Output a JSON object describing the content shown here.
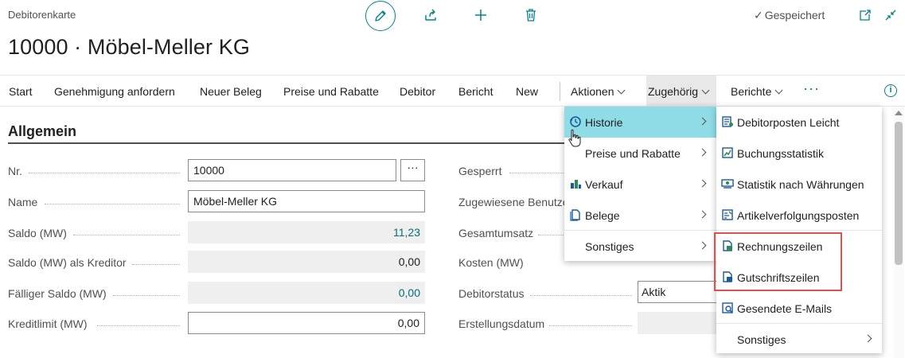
{
  "page": {
    "caption": "Debitorenkarte",
    "title": "10000 · Möbel-Meller KG",
    "saved_status": "Gespeichert"
  },
  "actionbar": {
    "items": [
      {
        "label": "Start"
      },
      {
        "label": "Genehmigung anfordern"
      },
      {
        "label": "Neuer Beleg"
      },
      {
        "label": "Preise und Rabatte"
      },
      {
        "label": "Debitor"
      },
      {
        "label": "Bericht"
      },
      {
        "label": "New"
      },
      {
        "label": "Aktionen"
      },
      {
        "label": "Zugehörig"
      },
      {
        "label": "Berichte"
      }
    ],
    "more": "···"
  },
  "section": {
    "title": "Allgemein"
  },
  "fields_left": [
    {
      "label": "Nr.",
      "value": "10000"
    },
    {
      "label": "Name",
      "value": "Möbel-Meller KG"
    },
    {
      "label": "Saldo (MW)",
      "value": "11,23"
    },
    {
      "label": "Saldo (MW) als Kreditor",
      "value": "0,00"
    },
    {
      "label": "Fälliger Saldo (MW)",
      "value": "0,00"
    },
    {
      "label": "Kreditlimit (MW)",
      "value": "0,00"
    }
  ],
  "lookup_button": "···",
  "fields_right": [
    {
      "label": "Gesperrt"
    },
    {
      "label": "Zugewiesene Benutzer"
    },
    {
      "label": "Gesamtumsatz"
    },
    {
      "label": "Kosten (MW)"
    },
    {
      "label": "Debitorstatus",
      "value": "Aktik"
    },
    {
      "label": "Erstellungsdatum"
    }
  ],
  "menu_zugehoerig": [
    {
      "label": "Historie",
      "icon": "history-icon",
      "active": true
    },
    {
      "label": "Preise und Rabatte",
      "icon": ""
    },
    {
      "label": "Verkauf",
      "icon": "sales-icon"
    },
    {
      "label": "Belege",
      "icon": "document-icon"
    },
    {
      "label": "Sonstiges",
      "icon": ""
    }
  ],
  "menu_historie": [
    {
      "label": "Debitorposten Leicht",
      "icon": "ledger-entries-icon"
    },
    {
      "label": "Buchungsstatistik",
      "icon": "posting-statistics-icon"
    },
    {
      "label": "Statistik nach Währungen",
      "icon": "currency-statistics-icon"
    },
    {
      "label": "Artikelverfolgungsposten",
      "icon": "item-tracing-icon"
    },
    {
      "label": "Rechnungszeilen",
      "icon": "invoice-lines-icon"
    },
    {
      "label": "Gutschriftszeilen",
      "icon": "credit-memo-lines-icon"
    },
    {
      "label": "Gesendete E-Mails",
      "icon": "sent-emails-icon"
    },
    {
      "label": "Sonstiges",
      "icon": ""
    }
  ],
  "colors": {
    "accent": "#008489",
    "menu_active": "#8fdbe6",
    "highlight_box": "#d9534f"
  }
}
